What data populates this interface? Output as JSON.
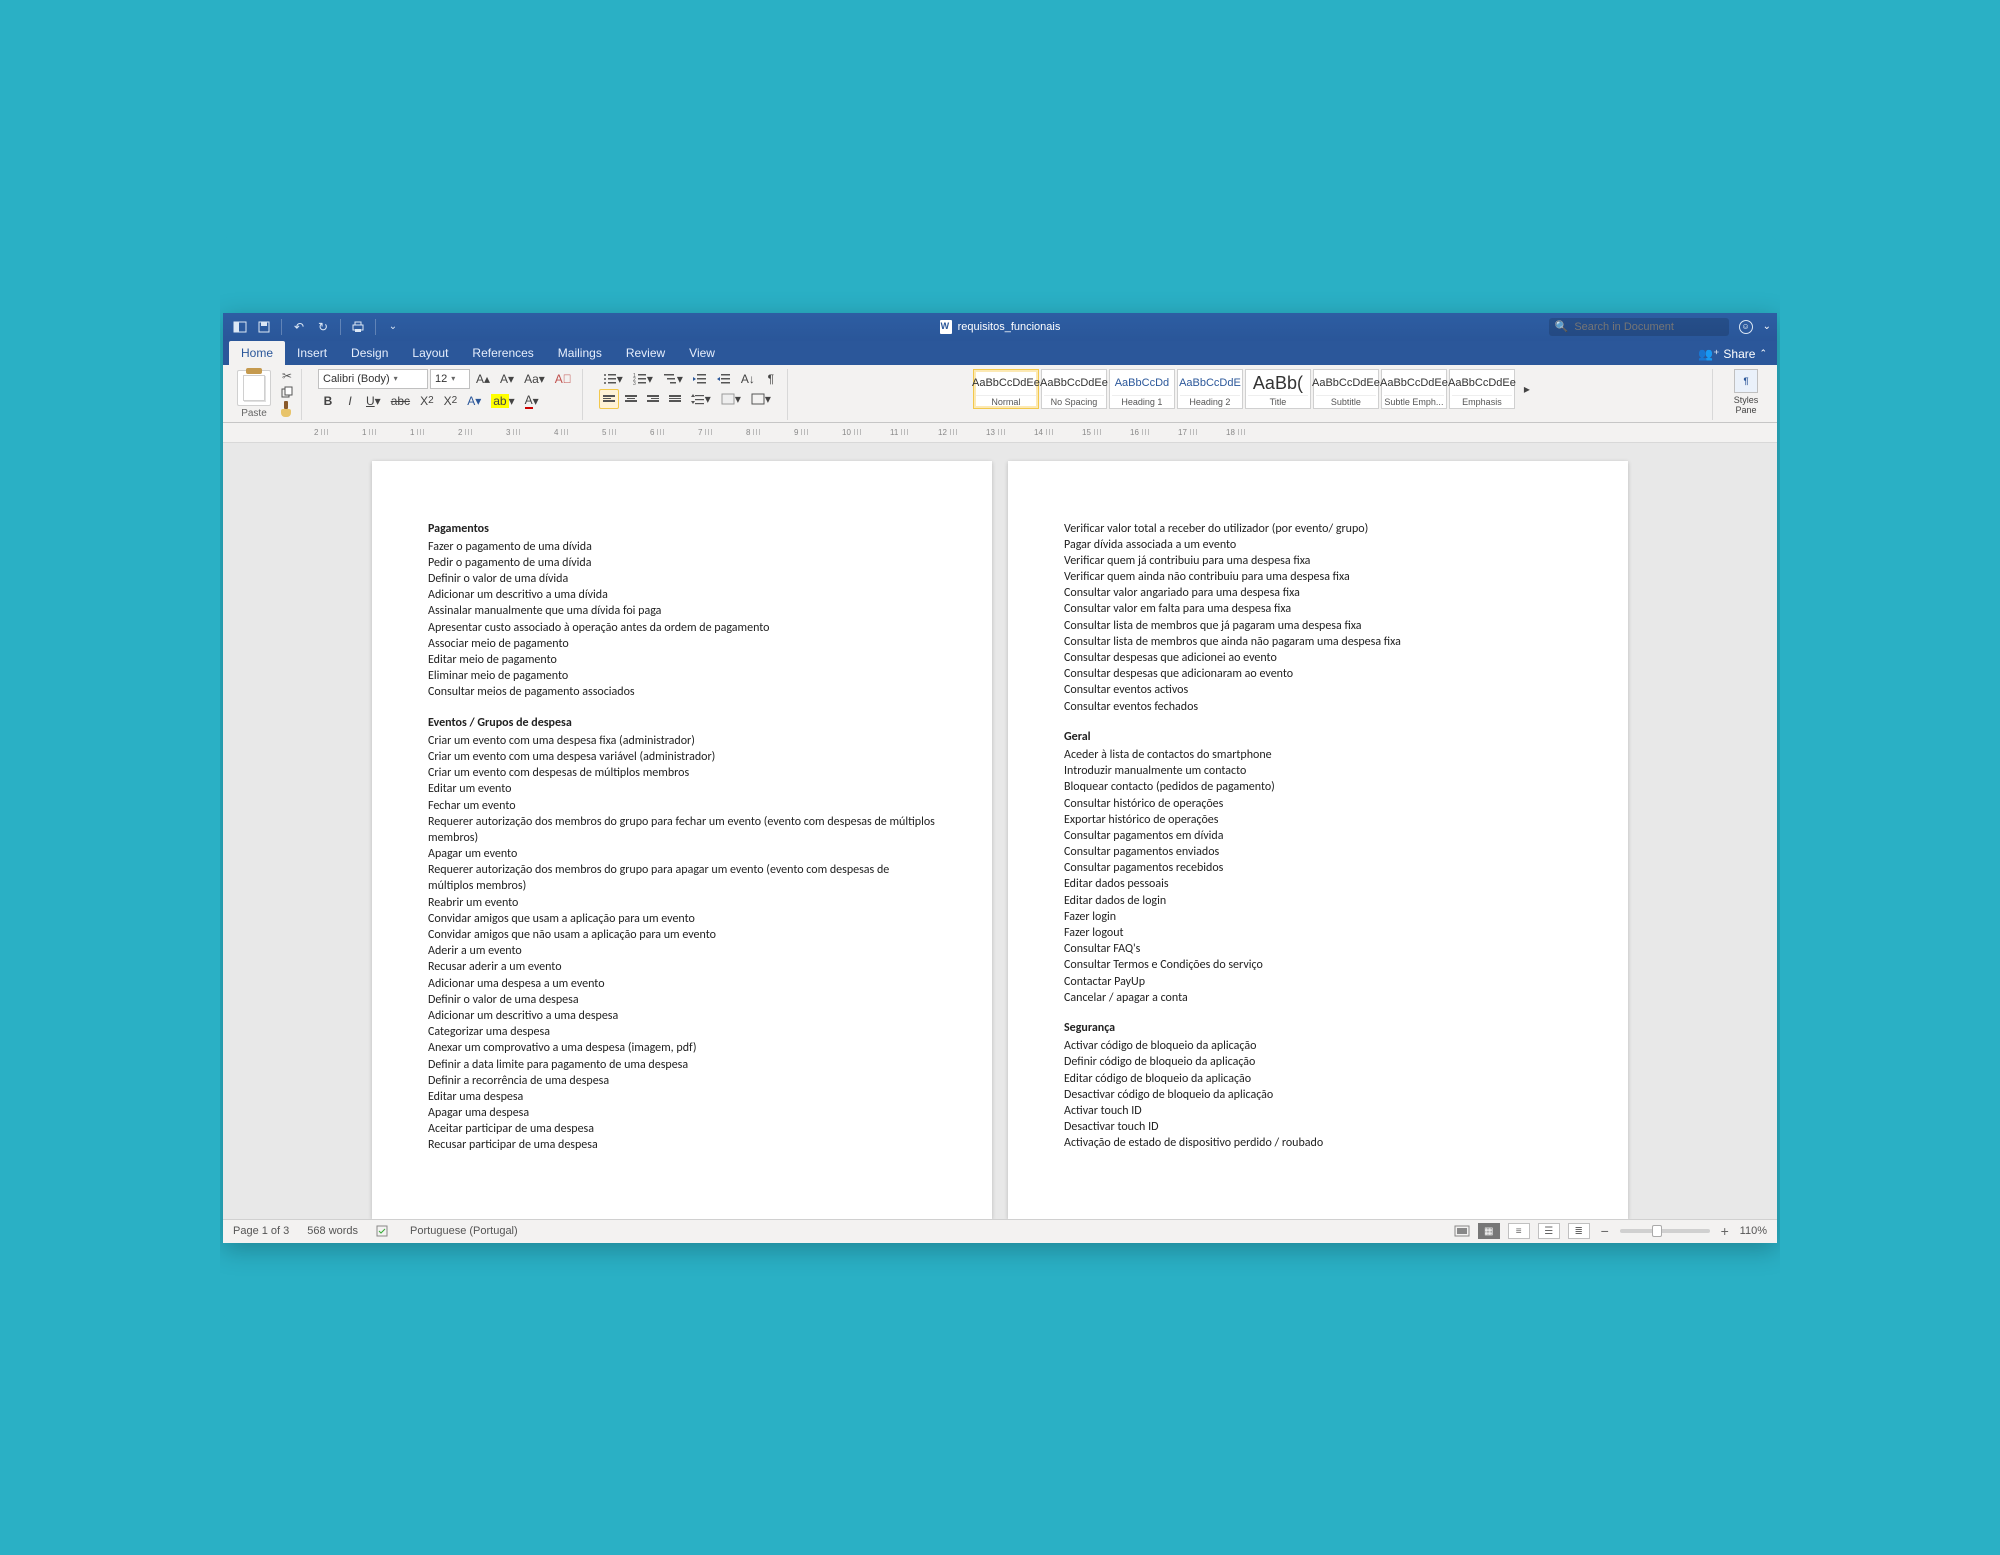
{
  "title": "requisitos_funcionais",
  "search_placeholder": "Search in Document",
  "tabs": [
    "Home",
    "Insert",
    "Design",
    "Layout",
    "References",
    "Mailings",
    "Review",
    "View"
  ],
  "active_tab": "Home",
  "share_label": "Share",
  "ribbon": {
    "paste_label": "Paste",
    "font_name": "Calibri (Body)",
    "font_size": "12",
    "styles": [
      {
        "sample": "AaBbCcDdEe",
        "label": "Normal",
        "blue": false,
        "sel": true
      },
      {
        "sample": "AaBbCcDdEe",
        "label": "No Spacing",
        "blue": false,
        "sel": false
      },
      {
        "sample": "AaBbCcDd",
        "label": "Heading 1",
        "blue": true,
        "sel": false
      },
      {
        "sample": "AaBbCcDdE",
        "label": "Heading 2",
        "blue": true,
        "sel": false
      },
      {
        "sample": "AaBb(",
        "label": "Title",
        "blue": false,
        "sel": false
      },
      {
        "sample": "AaBbCcDdEe",
        "label": "Subtitle",
        "blue": false,
        "sel": false
      },
      {
        "sample": "AaBbCcDdEe",
        "label": "Subtle Emph...",
        "blue": false,
        "sel": false
      },
      {
        "sample": "AaBbCcDdEe",
        "label": "Emphasis",
        "blue": false,
        "sel": false
      }
    ],
    "styles_pane": "Styles\nPane"
  },
  "ruler_numbers": [
    "2",
    "1",
    "1",
    "2",
    "3",
    "4",
    "5",
    "6",
    "7",
    "8",
    "9",
    "10",
    "11",
    "12",
    "13",
    "14",
    "15",
    "16",
    "17",
    "18"
  ],
  "page_left": {
    "sect1_title": "Pagamentos",
    "sect1_items": [
      "Fazer o pagamento de uma dívida",
      "Pedir o pagamento de uma dívida",
      "Definir o valor de uma dívida",
      "Adicionar um descritivo a uma dívida",
      "Assinalar manualmente que uma dívida foi paga",
      "Apresentar custo associado à operação antes da ordem de pagamento",
      "Associar meio de pagamento",
      "Editar meio de pagamento",
      "Eliminar meio de pagamento",
      "Consultar meios de pagamento associados"
    ],
    "sect2_title": "Eventos / Grupos de despesa",
    "sect2_items": [
      "Criar um evento com uma despesa fixa (administrador)",
      "Criar um evento com uma despesa variável (administrador)",
      "Criar um evento com despesas de múltiplos membros",
      "Editar um evento",
      "Fechar um evento",
      "Requerer autorização dos membros do grupo para fechar um evento (evento com despesas de múltiplos membros)",
      "Apagar um evento",
      "Requerer autorização dos membros do grupo para apagar um evento (evento com despesas de múltiplos membros)",
      "Reabrir um evento",
      "Convidar amigos que usam a aplicação para um evento",
      "Convidar amigos que não usam a aplicação para um evento",
      "Aderir a um evento",
      "Recusar aderir a um evento",
      "Adicionar uma despesa a um evento",
      "Definir o valor de uma despesa",
      "Adicionar um descritivo a uma despesa",
      "Categorizar uma despesa",
      "Anexar um comprovativo a uma despesa (imagem, pdf)",
      "Definir a data limite para pagamento de uma despesa",
      "Definir a recorrência de uma despesa",
      "Editar uma despesa",
      "Apagar uma despesa",
      "Aceitar participar de uma despesa",
      "Recusar participar de uma despesa"
    ]
  },
  "page_right": {
    "top_items": [
      "Verificar valor total a receber do utilizador (por evento/ grupo)",
      "Pagar dívida associada a um evento",
      "Verificar quem já contribuiu para uma despesa fixa",
      "Verificar quem ainda não contribuiu para uma despesa fixa",
      "Consultar valor angariado para uma despesa fixa",
      "Consultar valor em falta para uma despesa fixa",
      "Consultar lista de membros que já pagaram uma despesa fixa",
      "Consultar lista de membros que ainda não pagaram uma despesa fixa",
      "Consultar despesas que adicionei ao evento",
      "Consultar despesas que adicionaram ao evento",
      "Consultar eventos activos",
      "Consultar eventos fechados"
    ],
    "sect1_title": "Geral",
    "sect1_items": [
      "Aceder à lista de contactos do smartphone",
      "Introduzir manualmente um contacto",
      "Bloquear contacto (pedidos de pagamento)",
      "Consultar histórico de operações",
      "Exportar histórico de operações",
      "Consultar pagamentos em dívida",
      "Consultar pagamentos enviados",
      "Consultar pagamentos recebidos",
      "Editar dados pessoais",
      "Editar dados de login",
      "Fazer login",
      "Fazer logout",
      "Consultar FAQ's",
      "Consultar Termos e Condições do serviço",
      "Contactar PayUp",
      "Cancelar / apagar a conta"
    ],
    "sect2_title": "Segurança",
    "sect2_items": [
      "Activar código de bloqueio da aplicação",
      "Definir código de bloqueio da aplicação",
      "Editar código de bloqueio da aplicação",
      "Desactivar código de bloqueio da aplicação",
      "Activar touch ID",
      "Desactivar touch ID",
      "Activação de estado de dispositivo perdido / roubado"
    ]
  },
  "status": {
    "page": "Page 1 of 3",
    "words": "568 words",
    "lang": "Portuguese (Portugal)",
    "zoom": "110%"
  }
}
